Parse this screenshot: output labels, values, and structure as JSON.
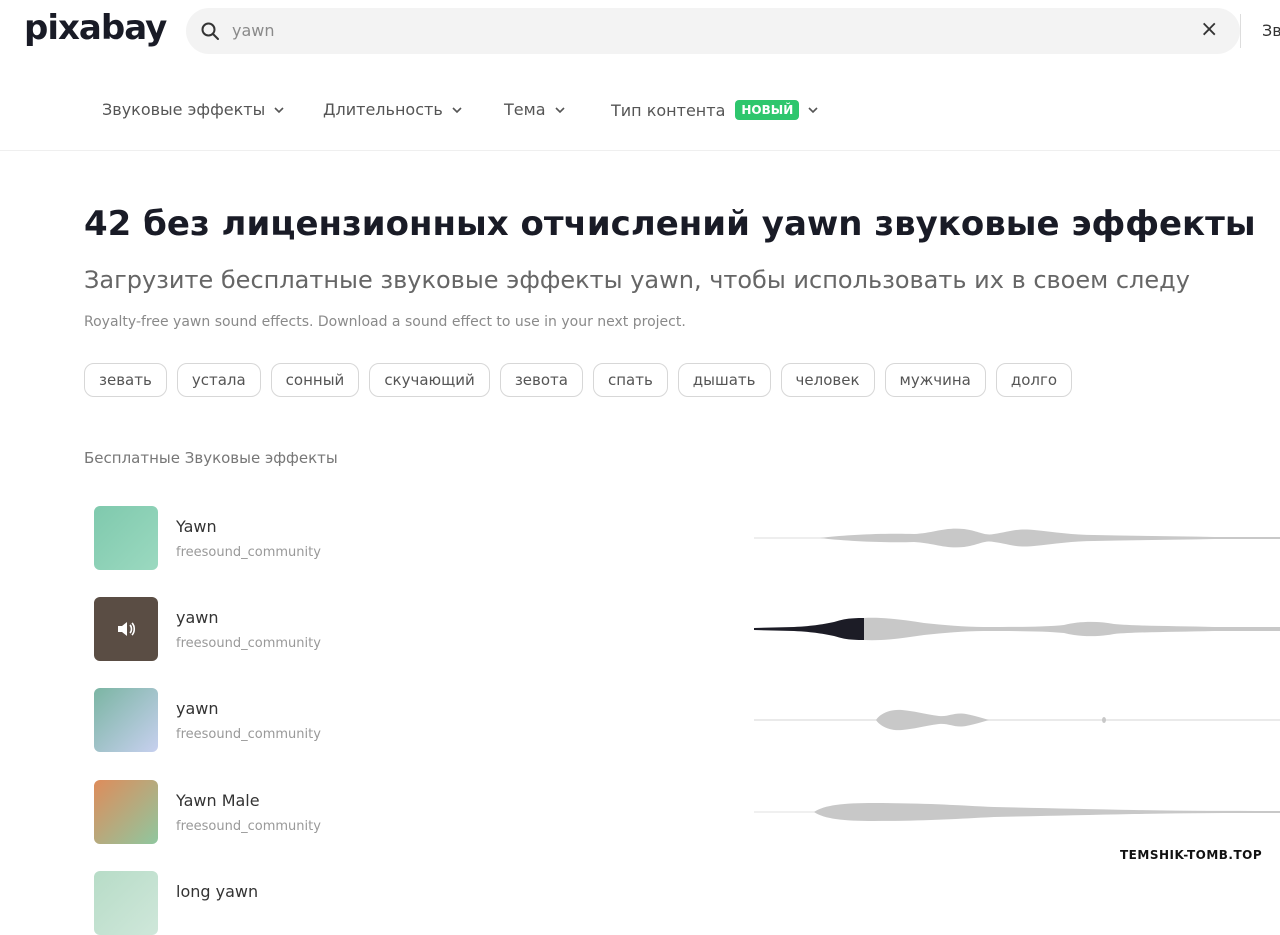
{
  "header": {
    "logo": "pixabay",
    "search_value": "yawn",
    "clear_label": "×",
    "nav_partial": "Зв"
  },
  "filters": [
    {
      "label": "Звуковые эффекты"
    },
    {
      "label": "Длительность"
    },
    {
      "label": "Тема"
    },
    {
      "label": "Тип контента",
      "badge": "НОВЫЙ"
    }
  ],
  "main": {
    "title": "42 без лицензионных отчислений yawn звуковые эффекты",
    "subtitle": "Загрузите бесплатные звуковые эффекты yawn, чтобы использовать их в своем следу",
    "description": "Royalty-free yawn sound effects. Download a sound effect to use in your next project.",
    "tags": [
      "зевать",
      "устала",
      "сонный",
      "скучающий",
      "зевота",
      "спать",
      "дышать",
      "человек",
      "мужчина",
      "долго"
    ],
    "section_label": "Бесплатные Звуковые эффекты"
  },
  "tracks": [
    {
      "title": "Yawn",
      "author": "freesound_community",
      "thumb_colors": [
        "#7fc9ad",
        "#9bd9c0"
      ],
      "playing": false
    },
    {
      "title": "yawn",
      "author": "freesound_community",
      "thumb_colors": [
        "#5a4d44",
        "#5a4d44"
      ],
      "playing": true
    },
    {
      "title": "yawn",
      "author": "freesound_community",
      "thumb_colors": [
        "#7bb5a3",
        "#c7d0ef"
      ],
      "playing": false
    },
    {
      "title": "Yawn Male",
      "author": "freesound_community",
      "thumb_colors": [
        "#de8c5b",
        "#8fc79f"
      ],
      "playing": false
    },
    {
      "title": "long yawn",
      "author": "",
      "thumb_colors": [
        "#b7dcc7",
        "#cfe7da"
      ],
      "playing": false
    }
  ],
  "watermark": "TEMSHIK-TOMB.TOP",
  "colors": {
    "accent_badge": "#2ec66d",
    "wave": "#c8c8c8",
    "wave_played": "#1c1c26"
  },
  "icons": {
    "search": "search-icon",
    "clear": "close-icon",
    "chevron": "chevron-down-icon",
    "speaker": "speaker-icon"
  }
}
